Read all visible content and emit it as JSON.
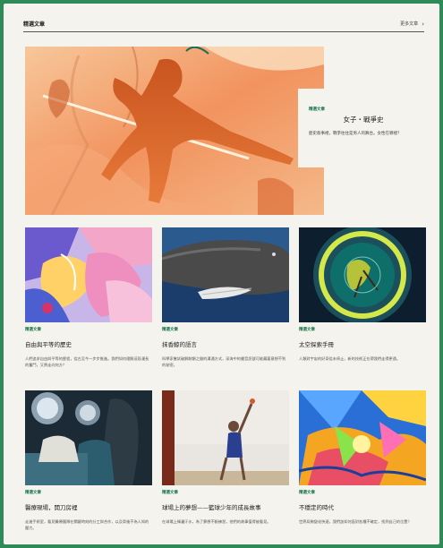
{
  "header": {
    "title": "精選文章",
    "more_label": "更多文章",
    "chevron": "›"
  },
  "hero": {
    "tag": "精選文章",
    "title": "女子・戰爭史",
    "excerpt": "歷史敘事裡，戰爭往往是男人的舞台。女性在哪裡？"
  },
  "cards": [
    {
      "tag": "精選文章",
      "title": "自由與平等的歷史",
      "excerpt": "人們追求自由與平等的歷程，從古至今一步步推進。我們如何理解這段漫長的奮鬥，又將走向何方？"
    },
    {
      "tag": "精選文章",
      "title": "抹香鯨的語言",
      "excerpt": "科學家嘗試破解鯨類之間的溝通方式，深海中的聲音訊號可能藏著意想不到的秘密。"
    },
    {
      "tag": "精選文章",
      "title": "太空探索手冊",
      "excerpt": "人類對宇宙的好奇從未停止，新的技術正在帶我們走得更遠。"
    },
    {
      "tag": "精選文章",
      "title": "醫療現場，開刀房裡",
      "excerpt": "走進手術室，看見醫療團隊在關鍵時刻的分工與合作，以及背後不為人知的壓力。"
    },
    {
      "tag": "精選文章",
      "title": "球場上的夢想——籃球少年的成長故事",
      "excerpt": "在球場上揮灑汗水，為了夢想不斷練習，他們的故事值得被看見。"
    },
    {
      "tag": "精選文章",
      "title": "不穩定的時代",
      "excerpt": "世界局勢變化快速，我們該如何面對各種不確定，找到自己的位置？"
    }
  ]
}
